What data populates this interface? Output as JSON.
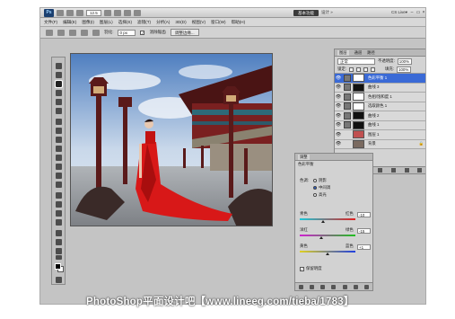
{
  "window": {
    "app_logo": "Ps",
    "zoom_level": "12.5",
    "workspace_button": "基本功能",
    "workspace_link": "设计 »",
    "cs_live": "CS Live▾",
    "controls": [
      "–",
      "▭",
      "×"
    ]
  },
  "menubar": {
    "items": [
      "文件(F)",
      "编辑(E)",
      "图像(I)",
      "图层(L)",
      "选择(S)",
      "滤镜(T)",
      "分析(A)",
      "3D(D)",
      "视图(V)",
      "窗口(W)",
      "帮助(H)"
    ]
  },
  "options": {
    "feather_label": "羽化:",
    "feather_value": "0 px",
    "antialias_label": "消除锯齿",
    "antialias_checked": "✓",
    "refine_edge_label": "调整边缘..."
  },
  "layers_panel": {
    "tabs": [
      "图层",
      "通道",
      "路径"
    ],
    "blend_mode": "正常",
    "opacity_label": "不透明度:",
    "opacity_value": "100%",
    "lock_label": "锁定:",
    "fill_label": "填充:",
    "fill_value": "100%",
    "layers": [
      {
        "name": "色彩平衡 1",
        "type": "adjustment",
        "mask": "white",
        "selected": true
      },
      {
        "name": "曲线 3",
        "type": "adjustment",
        "mask": "dark",
        "selected": false
      },
      {
        "name": "色相/饱和度 1",
        "type": "adjustment",
        "mask": "white",
        "selected": false
      },
      {
        "name": "选取颜色 1",
        "type": "adjustment",
        "mask": "white",
        "selected": false
      },
      {
        "name": "曲线 2",
        "type": "adjustment",
        "mask": "dark",
        "selected": false
      },
      {
        "name": "曲线 1",
        "type": "adjustment",
        "mask": "dark",
        "selected": false
      },
      {
        "name": "图层 1",
        "type": "pixel",
        "mask": "none",
        "selected": false
      },
      {
        "name": "背景",
        "type": "background",
        "mask": "none",
        "selected": false
      }
    ]
  },
  "adjustments_panel": {
    "title": "调整",
    "subtitle": "色彩平衡",
    "tone_label": "色调:",
    "tones": [
      {
        "label": "阴影",
        "selected": false
      },
      {
        "label": "中间调",
        "selected": true
      },
      {
        "label": "高光",
        "selected": false
      }
    ],
    "sliders": [
      {
        "left": "青色",
        "right": "红色",
        "value": "-10",
        "position": 0.42,
        "color_left": "#19c8d8",
        "color_right": "#e02020"
      },
      {
        "left": "洋红",
        "right": "绿色",
        "value": "-15",
        "position": 0.38,
        "color_left": "#d020d0",
        "color_right": "#20c020"
      },
      {
        "left": "黄色",
        "right": "蓝色",
        "value": "+1",
        "position": 0.5,
        "color_left": "#e0d020",
        "color_right": "#2040e0"
      }
    ],
    "preserve_luminosity": "保留明度",
    "preserve_checked": "✓"
  },
  "watermark": "PhotoShop平面设计吧【www.lineeg.com/tieba/1783】",
  "colors": {
    "selection": "#3a6ad6",
    "dress": "#d81818",
    "roof": "#5a1a1a"
  }
}
